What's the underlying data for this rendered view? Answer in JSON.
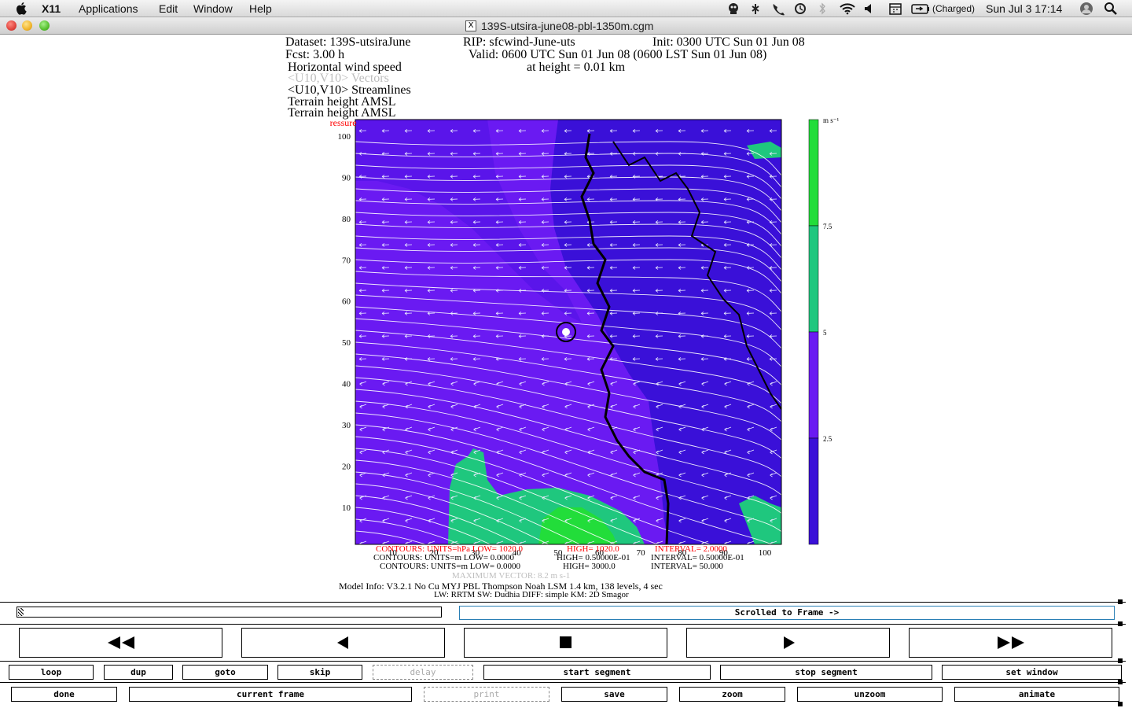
{
  "menubar": {
    "app_name": "X11",
    "items": [
      "Applications",
      "Edit",
      "Window",
      "Help"
    ],
    "battery_status": "(Charged)",
    "clock": "Sun Jul 3  17:14"
  },
  "window": {
    "title": "139S-utsira-june08-pbl-1350m.cgm",
    "x_icon": "X"
  },
  "plot_header": {
    "dataset": "Dataset: 139S-utsiraJune",
    "rip": "RIP: sfcwind-June-uts",
    "init": "Init: 0300 UTC Sun 01 Jun 08",
    "fcst": "Fcst:    3.00 h",
    "valid": "Valid: 0600 UTC Sun 01 Jun 08 (0600 LST Sun 01 Jun 08)",
    "field1": "Horizontal wind speed",
    "height": "at height =  0.01 km",
    "field2": "<U10,V10> Vectors",
    "field3": "<U10,V10> Streamlines",
    "field4": "Terrain height AMSL",
    "field5": "Terrain height AMSL",
    "field6": "Sea-level pressure"
  },
  "chart_data": {
    "type": "heatmap",
    "xlim": [
      1,
      104
    ],
    "ylim": [
      1,
      104
    ],
    "x_ticks": [
      "10",
      "20",
      "30",
      "40",
      "50",
      "60",
      "70",
      "80",
      "90",
      "100"
    ],
    "y_ticks": [
      "10",
      "20",
      "30",
      "40",
      "50",
      "60",
      "70",
      "80",
      "90",
      "100"
    ],
    "colorbar_unit": "m s⁻¹",
    "colorbar_ticks": [
      "2.5",
      "5",
      "7.5"
    ],
    "colorbar_colors": [
      "#3a10d8",
      "#6a1af2",
      "#1fc77e",
      "#22dd3a"
    ],
    "contour_lines": [
      {
        "units": "CONTOURS:  UNITS=hPa   LOW=  1020.0",
        "high": "HIGH=  1020.0",
        "interval": "INTERVAL=   2.0000",
        "color": "#ff0000"
      },
      {
        "units": "CONTOURS:  UNITS=m  LOW=   0.0000",
        "high": "HIGH= 0.50000E-01",
        "interval": "INTERVAL=  0.50000E-01",
        "color": "#000000"
      },
      {
        "units": "CONTOURS:  UNITS=m  LOW=  0.0000",
        "high": "HIGH=   3000.0",
        "interval": "INTERVAL=   50.000",
        "color": "#000000"
      }
    ],
    "max_vector": "MAXIMUM VECTOR:   8.2 m s-1",
    "model_info": "Model Info: V3.2.1    No Cu    MYJ PBL   Thompson      Noah LSM    1.4 km, 138 levels,    4 sec",
    "model_info2": "LW: RRTM  SW: Dudhia   DIFF: simple  KM: 2D Smagor"
  },
  "controls": {
    "scrolled_label": "Scrolled to Frame ->",
    "row1": [
      "loop",
      "dup",
      "goto",
      "skip",
      "delay",
      "start segment",
      "stop segment",
      "set window"
    ],
    "row2": [
      "done",
      "current frame",
      "print",
      "save",
      "zoom",
      "unzoom",
      "animate"
    ]
  }
}
